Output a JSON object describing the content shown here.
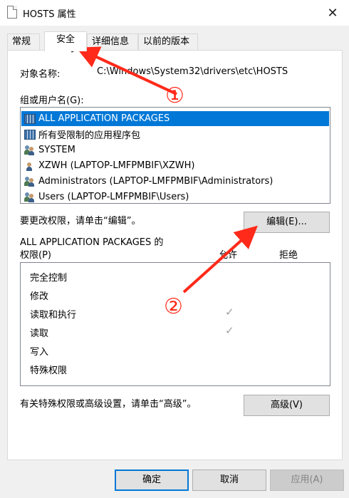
{
  "window": {
    "title": "HOSTS 属性",
    "close_glyph": "✕"
  },
  "tabs": [
    {
      "label": "常规"
    },
    {
      "label": "安全"
    },
    {
      "label": "详细信息"
    },
    {
      "label": "以前的版本"
    }
  ],
  "active_tab": "安全",
  "security": {
    "object_label": "对象名称:",
    "object_value": "C:\\Windows\\System32\\drivers\\etc\\HOSTS",
    "group_label": "组或用户名(G):",
    "users": [
      {
        "name": "ALL APPLICATION PACKAGES",
        "icon": "package-icon",
        "selected": true
      },
      {
        "name": "所有受限制的应用程序包",
        "icon": "package-icon",
        "selected": false
      },
      {
        "name": "SYSTEM",
        "icon": "users-icon",
        "selected": false
      },
      {
        "name": "XZWH (LAPTOP-LMFPMBIF\\XZWH)",
        "icon": "user-icon",
        "selected": false
      },
      {
        "name": "Administrators (LAPTOP-LMFPMBIF\\Administrators)",
        "icon": "users-icon",
        "selected": false
      },
      {
        "name": "Users (LAPTOP-LMFPMBIF\\Users)",
        "icon": "users-icon",
        "selected": false
      }
    ],
    "change_hint": "要更改权限，请单击“编辑”。",
    "edit_button": "编辑(E)...",
    "perm_title_line1": "ALL APPLICATION PACKAGES 的",
    "perm_title_line2": "权限(P)",
    "allow_header": "允许",
    "deny_header": "拒绝",
    "permissions": [
      {
        "name": "完全控制",
        "allow": false,
        "deny": false
      },
      {
        "name": "修改",
        "allow": false,
        "deny": false
      },
      {
        "name": "读取和执行",
        "allow": true,
        "deny": false
      },
      {
        "name": "读取",
        "allow": true,
        "deny": false
      },
      {
        "name": "写入",
        "allow": false,
        "deny": false
      },
      {
        "name": "特殊权限",
        "allow": false,
        "deny": false
      }
    ],
    "check_glyph": "✓",
    "advanced_hint": "有关特殊权限或高级设置，请单击“高级”。",
    "advanced_button": "高级(V)"
  },
  "footer": {
    "ok": "确定",
    "cancel": "取消",
    "apply": "应用(A)"
  },
  "annotations": {
    "marker_1": "①",
    "marker_2": "②",
    "color": "#ff2a1a"
  }
}
